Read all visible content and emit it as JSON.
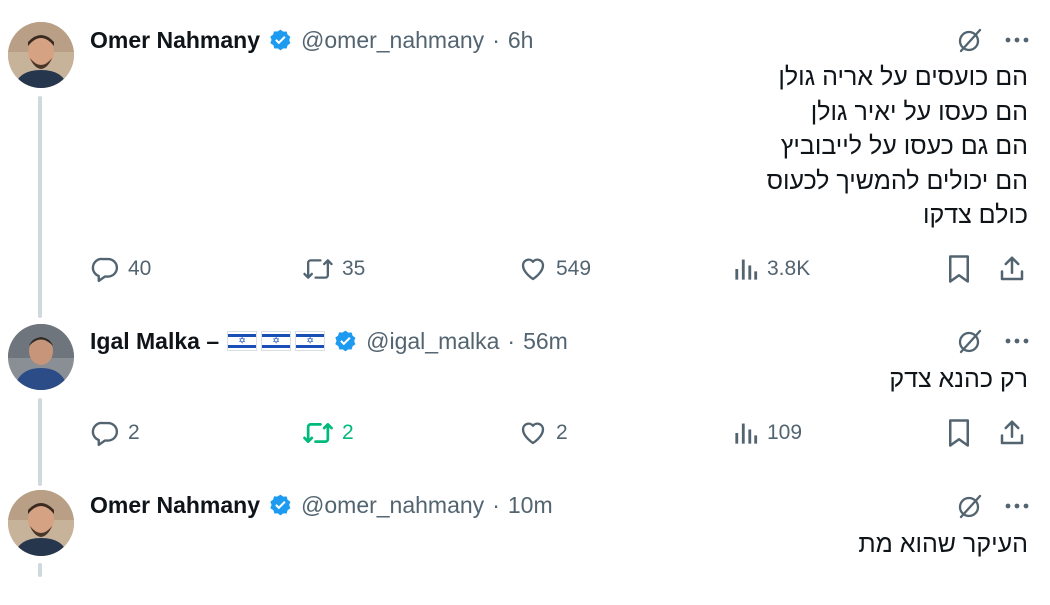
{
  "tweets": [
    {
      "name": "Omer Nahmany",
      "handle": "@omer_nahmany",
      "separator": "·",
      "time": "6h",
      "text": "הם כועסים על אריה גולן\nהם כעסו על יאיר גולן\nהם גם כעסו על לייבוביץ\nהם יכולים להמשיך לכעוס\nכולם צדקו",
      "replies": "40",
      "retweets": "35",
      "likes": "549",
      "views": "3.8K",
      "retweeted": false,
      "icons": [
        "grok-icon",
        "more-icon",
        "reply-icon",
        "retweet-icon",
        "like-icon",
        "views-icon",
        "bookmark-icon",
        "share-icon"
      ]
    },
    {
      "name": "Igal Malka –",
      "name_flags": [
        "israel-flag",
        "israel-flag",
        "israel-flag"
      ],
      "handle": "@igal_malka",
      "separator": "·",
      "time": "56m",
      "text": "רק כהנא צדק",
      "replies": "2",
      "retweets": "2",
      "likes": "2",
      "views": "109",
      "retweeted": true
    },
    {
      "name": "Omer Nahmany",
      "handle": "@omer_nahmany",
      "separator": "·",
      "time": "10m",
      "text": "העיקר שהוא מת"
    }
  ],
  "colors": {
    "text": "#0f1419",
    "secondary": "#536471",
    "verified": "#1d9bf0",
    "retweet_active": "#00ba7c",
    "thread_line": "#cfd9de"
  }
}
